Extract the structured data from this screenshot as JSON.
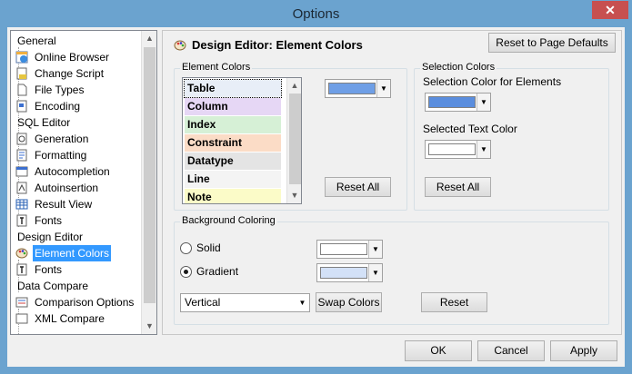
{
  "window": {
    "title": "Options",
    "close_glyph": "✕"
  },
  "tree": {
    "items": [
      {
        "label": "General",
        "type": "category"
      },
      {
        "label": "Online Browser",
        "icon": "browser-icon"
      },
      {
        "label": "Change Script",
        "icon": "script-icon"
      },
      {
        "label": "File Types",
        "icon": "file-icon"
      },
      {
        "label": "Encoding",
        "icon": "encoding-icon"
      },
      {
        "label": "SQL Editor",
        "type": "category"
      },
      {
        "label": "Generation",
        "icon": "generation-icon"
      },
      {
        "label": "Formatting",
        "icon": "formatting-icon"
      },
      {
        "label": "Autocompletion",
        "icon": "autocompletion-icon"
      },
      {
        "label": "Autoinsertion",
        "icon": "autoinsertion-icon"
      },
      {
        "label": "Result View",
        "icon": "grid-icon"
      },
      {
        "label": "Fonts",
        "icon": "font-icon"
      },
      {
        "label": "Design Editor",
        "type": "category"
      },
      {
        "label": "Element Colors",
        "icon": "palette-icon",
        "selected": true
      },
      {
        "label": "Fonts",
        "icon": "font-icon"
      },
      {
        "label": "Data Compare",
        "type": "category"
      },
      {
        "label": "Comparison Options",
        "icon": "compare-icon"
      },
      {
        "label": "XML Compare",
        "icon": "xml-icon"
      }
    ]
  },
  "header": {
    "title": "Design Editor: Element Colors",
    "reset_page_label": "Reset to Page Defaults"
  },
  "element_colors": {
    "group_title": "Element Colors",
    "items": [
      {
        "label": "Table",
        "color": "#e8eef7",
        "selected": true
      },
      {
        "label": "Column",
        "color": "#e6d7f5"
      },
      {
        "label": "Index",
        "color": "#d6f0d6"
      },
      {
        "label": "Constraint",
        "color": "#fbdcc6"
      },
      {
        "label": "Datatype",
        "color": "#e4e4e4"
      },
      {
        "label": "Line",
        "color": "#f4f4f4"
      },
      {
        "label": "Note",
        "color": "#fbfbc8"
      }
    ],
    "picker_color": "#6f9fe6",
    "reset_label": "Reset All"
  },
  "selection_colors": {
    "group_title": "Selection Colors",
    "elements_label": "Selection Color for Elements",
    "elements_color": "#5b8ede",
    "text_label": "Selected Text Color",
    "text_color": "#ffffff",
    "reset_label": "Reset All"
  },
  "background": {
    "group_title": "Background Coloring",
    "solid_label": "Solid",
    "solid_color": "#ffffff",
    "gradient_label": "Gradient",
    "gradient_color": "#d3e1f7",
    "gradient_selected": true,
    "direction_value": "Vertical",
    "swap_label": "Swap Colors",
    "reset_label": "Reset"
  },
  "footer": {
    "ok_label": "OK",
    "cancel_label": "Cancel",
    "apply_label": "Apply"
  },
  "colors": {
    "accent": "#3399ff",
    "titlebar": "#6ba3cf",
    "close": "#c75050"
  }
}
